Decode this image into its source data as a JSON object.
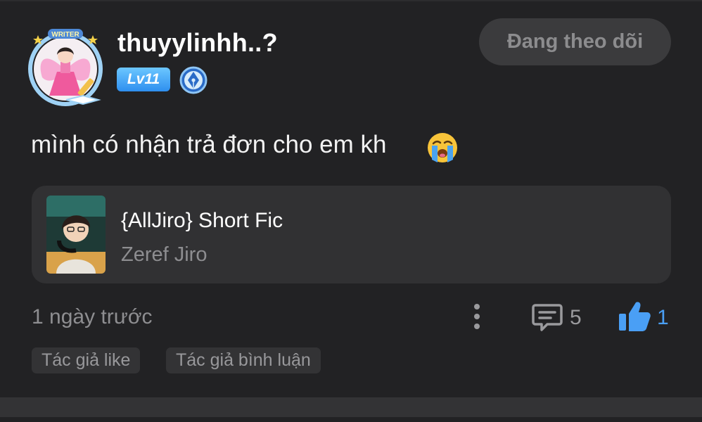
{
  "user": {
    "name": "thuyylinhh..?",
    "level": "Lv11",
    "avatar_banner": "WRITER"
  },
  "follow_button": {
    "label": "Đang theo dõi"
  },
  "comment": {
    "text": "mình có nhận trả đơn cho em kh",
    "emoji": "loudly-crying-face"
  },
  "story": {
    "title": "{AllJiro} Short Fic",
    "author": "Zeref Jiro"
  },
  "meta": {
    "time": "1 ngày trước",
    "comment_count": "5",
    "like_count": "1"
  },
  "tags": {
    "author_like": "Tác giả like",
    "author_comment": "Tác giả bình luận"
  },
  "colors": {
    "background": "#222224",
    "card": "#313133",
    "accent_blue": "#4a9ff5",
    "muted_text": "#8e8e91"
  }
}
